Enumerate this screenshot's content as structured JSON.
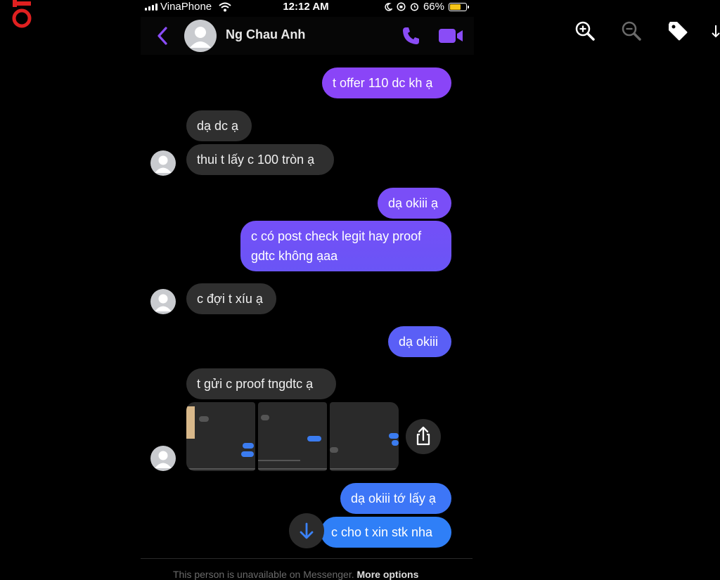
{
  "status_bar": {
    "carrier": "VinaPhone",
    "time": "12:12 AM",
    "battery": "66%"
  },
  "header": {
    "contact_name": "Ng Chau Anh"
  },
  "toolbar": {
    "icons": [
      "zoom-in-icon",
      "zoom-out-icon",
      "tag-icon"
    ]
  },
  "messages": [
    {
      "from": "me",
      "text": "t offer 110 dc kh ạ"
    },
    {
      "from": "them",
      "text": "dạ dc ạ"
    },
    {
      "from": "them",
      "text": "thui t lấy c 100 tròn ạ"
    },
    {
      "from": "me",
      "text": "dạ okiii ạ"
    },
    {
      "from": "me",
      "lines": [
        "c có post check legit hay proof",
        "gdtc không ạaa"
      ]
    },
    {
      "from": "them",
      "text": "c đợi t xíu ạ"
    },
    {
      "from": "me",
      "text": "dạ okiii"
    },
    {
      "from": "them",
      "text": "t gửi c proof tngdtc ạ"
    },
    {
      "from": "them",
      "type": "image-attachments",
      "count": 3
    },
    {
      "from": "me",
      "text": "dạ okiii tớ lấy ạ"
    },
    {
      "from": "me",
      "text": "c cho t xin stk nha"
    }
  ],
  "footer": {
    "notice": "This person is unavailable on Messenger.",
    "more_options": "More options"
  },
  "colors": {
    "accent": "#8a4cf6",
    "incoming_bubble": "#2f2f2f",
    "outgoing_top": "#8a45f7",
    "outgoing_bottom": "#2f7ff7",
    "logo_red": "#e02020"
  }
}
